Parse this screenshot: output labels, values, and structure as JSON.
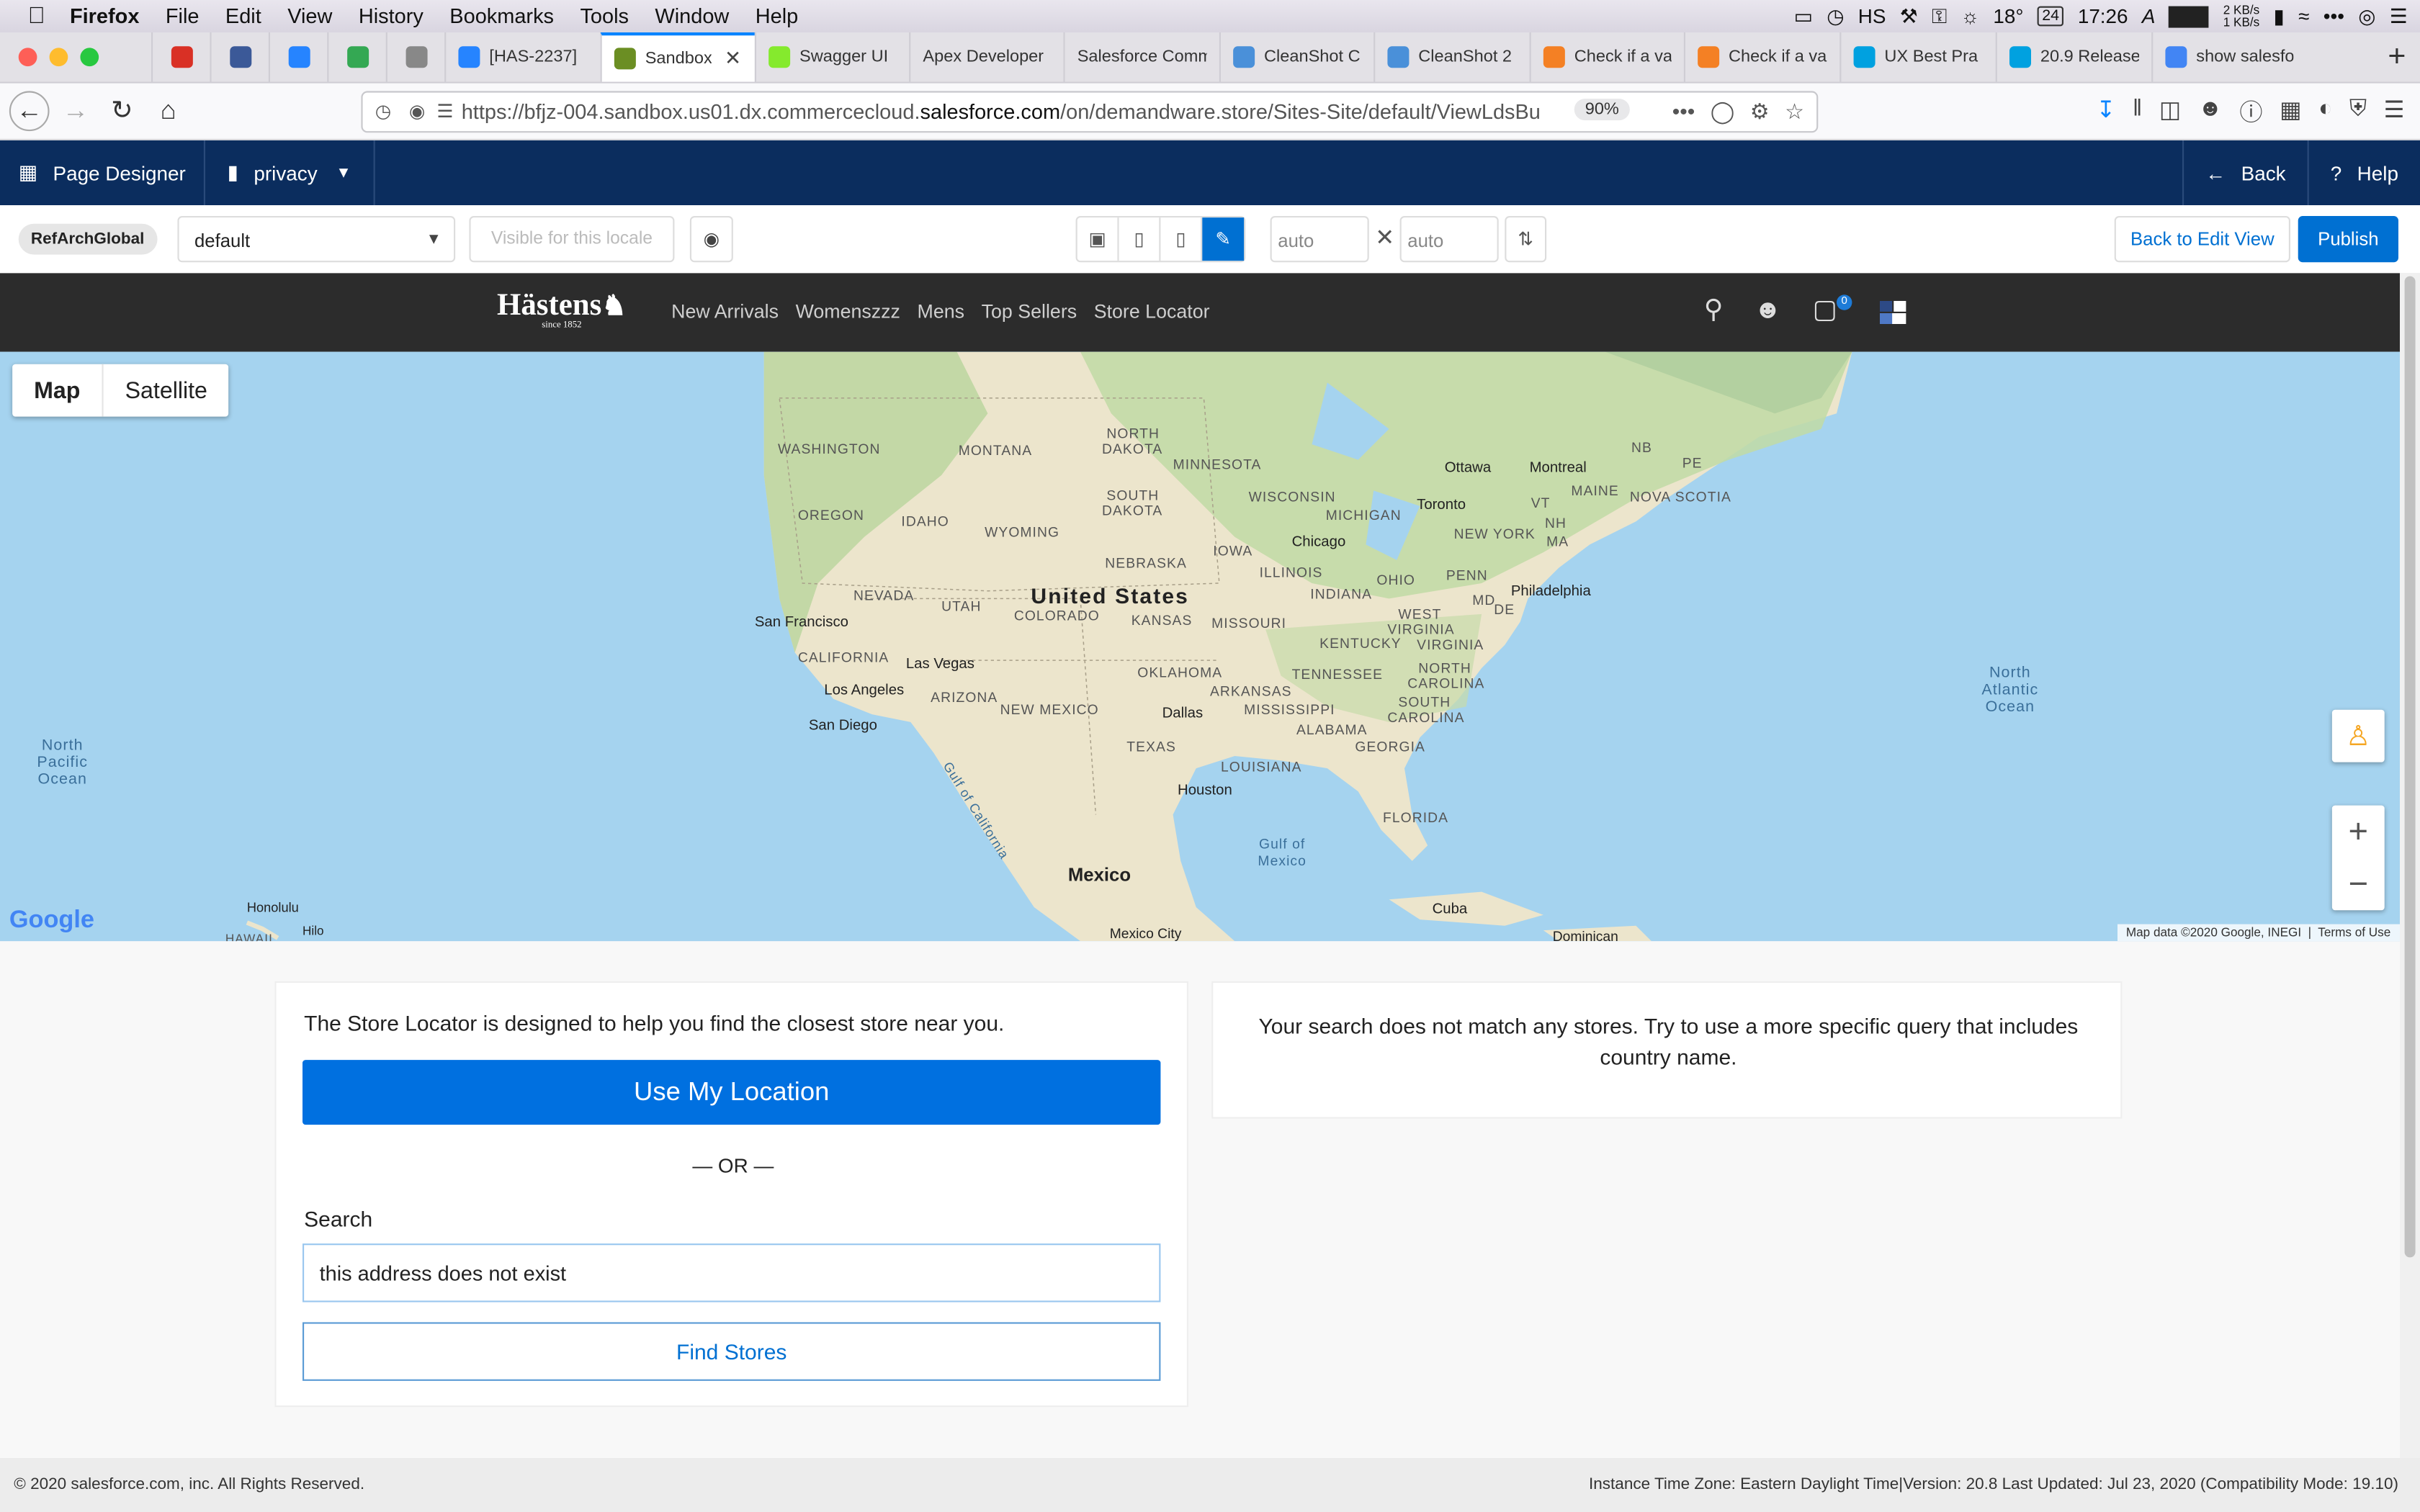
{
  "macos": {
    "app": "Firefox",
    "menus": [
      "File",
      "Edit",
      "View",
      "History",
      "Bookmarks",
      "Tools",
      "Window",
      "Help"
    ],
    "status": {
      "user": "HS",
      "temp": "18°",
      "date": "24",
      "time": "17:26",
      "net_up": "2 KB/s",
      "net_down": "1 KB/s"
    }
  },
  "tabs": [
    {
      "label": "",
      "fav": "#d93025",
      "pinned": true
    },
    {
      "label": "",
      "fav": "#3b5998",
      "pinned": true
    },
    {
      "label": "",
      "fav": "#2684ff",
      "pinned": true
    },
    {
      "label": "",
      "fav": "#34a853",
      "pinned": true
    },
    {
      "label": "",
      "fav": "#888888",
      "pinned": true
    },
    {
      "label": "[HAS-2237]",
      "fav": "#2684ff"
    },
    {
      "label": "Sandbox",
      "fav": "#6b8e23",
      "active": true
    },
    {
      "label": "Swagger UI",
      "fav": "#85ea2d"
    },
    {
      "label": "Apex Developer",
      "fav": ""
    },
    {
      "label": "Salesforce Comm",
      "fav": ""
    },
    {
      "label": "CleanShot C",
      "fav": "#4a90d9"
    },
    {
      "label": "CleanShot 2",
      "fav": "#4a90d9"
    },
    {
      "label": "Check if a va",
      "fav": "#f48024"
    },
    {
      "label": "Check if a va",
      "fav": "#f48024"
    },
    {
      "label": "UX Best Pra",
      "fav": "#00a1e0"
    },
    {
      "label": "20.9 Release",
      "fav": "#00a1e0"
    },
    {
      "label": "show salesfo",
      "fav": "#4285f4"
    }
  ],
  "url": {
    "prefix": "https://bfjz-004.sandbox.us01.dx.commercecloud.",
    "domain": "salesforce.com",
    "suffix": "/on/demandware.store/Sites-Site/default/ViewLdsBu",
    "zoom": "90%"
  },
  "pagedesigner": {
    "title": "Page Designer",
    "page": "privacy",
    "back": "Back",
    "help": "Help"
  },
  "toolbar": {
    "site": "RefArchGlobal",
    "locale": "default",
    "visible_placeholder": "Visible for this locale",
    "width": "auto",
    "height": "auto",
    "back_to_edit": "Back to Edit View",
    "publish": "Publish"
  },
  "site": {
    "logo": "Hästens",
    "since": "since 1852",
    "nav": [
      "New Arrivals",
      "Womenszzz",
      "Mens",
      "Top Sellers",
      "Store Locator"
    ],
    "cart_count": "0"
  },
  "map": {
    "map_tab": "Map",
    "satellite_tab": "Satellite",
    "attribution": "Map data ©2020 Google, INEGI",
    "terms": "Terms of Use",
    "google": "Google",
    "country": "United States",
    "mexico": "Mexico",
    "oceans": {
      "npac1": "North",
      "npac2": "Pacific",
      "npac3": "Ocean",
      "natl1": "North",
      "natl2": "Atlantic",
      "natl3": "Ocean",
      "gulf1": "Gulf of",
      "gulf2": "Mexico",
      "gcal": "Gulf of California"
    },
    "states": {
      "wa": "WASHINGTON",
      "or": "OREGON",
      "id": "IDAHO",
      "mt": "MONTANA",
      "wy": "WYOMING",
      "nd": "NORTH",
      "nd2": "DAKOTA",
      "sd": "SOUTH",
      "sd2": "DAKOTA",
      "mn": "MINNESOTA",
      "wi": "WISCONSIN",
      "mi": "MICHIGAN",
      "ne": "NEBRASKA",
      "ia": "IOWA",
      "il": "ILLINOIS",
      "in": "INDIANA",
      "oh": "OHIO",
      "pa": "PENN",
      "ny": "NEW YORK",
      "nv": "NEVADA",
      "ut": "UTAH",
      "co": "COLORADO",
      "ks": "KANSAS",
      "mo": "MISSOURI",
      "ky": "KENTUCKY",
      "wv": "WEST",
      "wv2": "VIRGINIA",
      "va": "VIRGINIA",
      "ca": "CALIFORNIA",
      "az": "ARIZONA",
      "nm": "NEW MEXICO",
      "ok": "OKLAHOMA",
      "ar": "ARKANSAS",
      "tn": "TENNESSEE",
      "nc": "NORTH",
      "nc2": "CAROLINA",
      "sc": "SOUTH",
      "sc2": "CAROLINA",
      "ms": "MISSISSIPPI",
      "al": "ALABAMA",
      "ga": "GEORGIA",
      "tx": "TEXAS",
      "la": "LOUISIANA",
      "fl": "FLORIDA",
      "me": "MAINE",
      "vt": "VT",
      "nh": "NH",
      "ma": "MA",
      "md": "MD",
      "de": "DE",
      "nb": "NB",
      "pe": "PE",
      "ns": "NOVA SCOTIA"
    },
    "cities": {
      "sf": "San Francisco",
      "lv": "Las Vegas",
      "la": "Los Angeles",
      "sd": "San Diego",
      "dal": "Dallas",
      "hou": "Houston",
      "chi": "Chicago",
      "tor": "Toronto",
      "ott": "Ottawa",
      "mtl": "Montreal",
      "phl": "Philadelphia",
      "hon": "Honolulu",
      "hilo": "Hilo",
      "hawaii": "HAWAII",
      "mxc": "Mexico City",
      "cuba": "Cuba",
      "dom": "Dominican"
    }
  },
  "locator": {
    "intro": "The Store Locator is designed to help you find the closest store near you.",
    "use_location": "Use My Location",
    "or": "— OR —",
    "search_label": "Search",
    "search_value": "this address does not exist",
    "find": "Find Stores",
    "no_results": "Your search does not match any stores. Try to use a more specific query that includes country name."
  },
  "footer": {
    "copyright": "© 2020 salesforce.com, inc. All Rights Reserved.",
    "info": "Instance Time Zone: Eastern Daylight Time|Version: 20.8 Last Updated: Jul 23, 2020 (Compatibility Mode: 19.10)"
  }
}
